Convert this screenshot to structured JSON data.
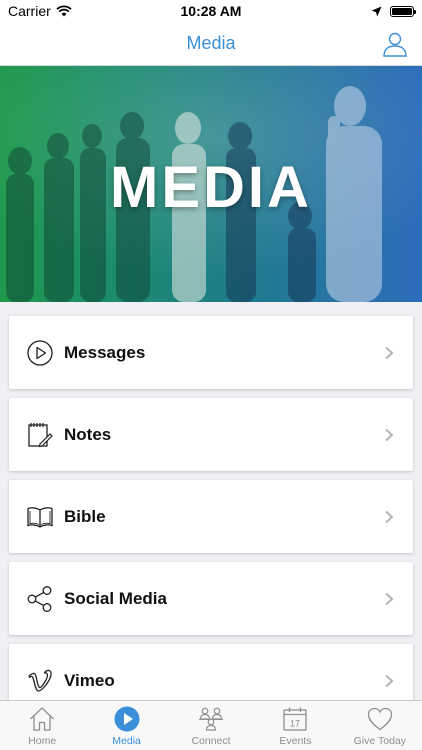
{
  "status_bar": {
    "carrier": "Carrier",
    "time": "10:28 AM"
  },
  "nav": {
    "title": "Media"
  },
  "hero": {
    "title": "MEDIA"
  },
  "menu": [
    {
      "label": "Messages",
      "icon": "play-circle-icon"
    },
    {
      "label": "Notes",
      "icon": "notepad-icon"
    },
    {
      "label": "Bible",
      "icon": "book-icon"
    },
    {
      "label": "Social Media",
      "icon": "share-icon"
    },
    {
      "label": "Vimeo",
      "icon": "vimeo-icon"
    }
  ],
  "tabs": [
    {
      "label": "Home",
      "icon": "home-icon",
      "active": false
    },
    {
      "label": "Media",
      "icon": "play-icon",
      "active": true
    },
    {
      "label": "Connect",
      "icon": "people-icon",
      "active": false
    },
    {
      "label": "Events",
      "icon": "calendar-icon",
      "active": false
    },
    {
      "label": "Give Today",
      "icon": "heart-icon",
      "active": false
    }
  ],
  "calendar_day": "17",
  "colors": {
    "accent": "#3a8fd8",
    "hero_green": "#1f9a4c",
    "hero_blue": "#2d6dbb"
  }
}
